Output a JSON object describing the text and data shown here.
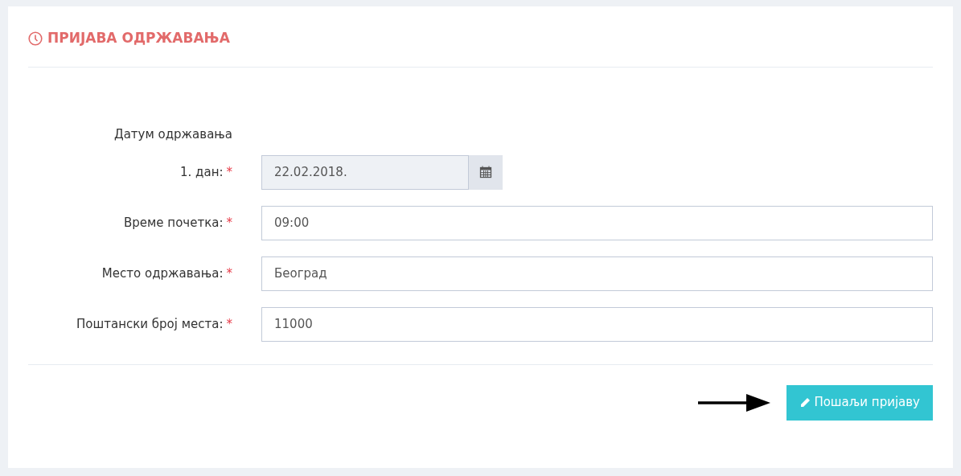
{
  "title": "ПРИЈАВА ОДРЖАВАЊА",
  "section_label": "Датум одржавања",
  "fields": [
    {
      "kind": "date",
      "label": "1. дан:",
      "required_mark": "*",
      "value": "22.02.2018."
    },
    {
      "kind": "text",
      "label": "Време почетка:",
      "required_mark": "*",
      "value": "09:00"
    },
    {
      "kind": "text",
      "label": "Место одржавања:",
      "required_mark": "*",
      "value": "Београд"
    },
    {
      "kind": "text",
      "label": "Поштански број места:",
      "required_mark": "*",
      "value": "11000"
    }
  ],
  "submit_button": "Пошаљи пријаву"
}
